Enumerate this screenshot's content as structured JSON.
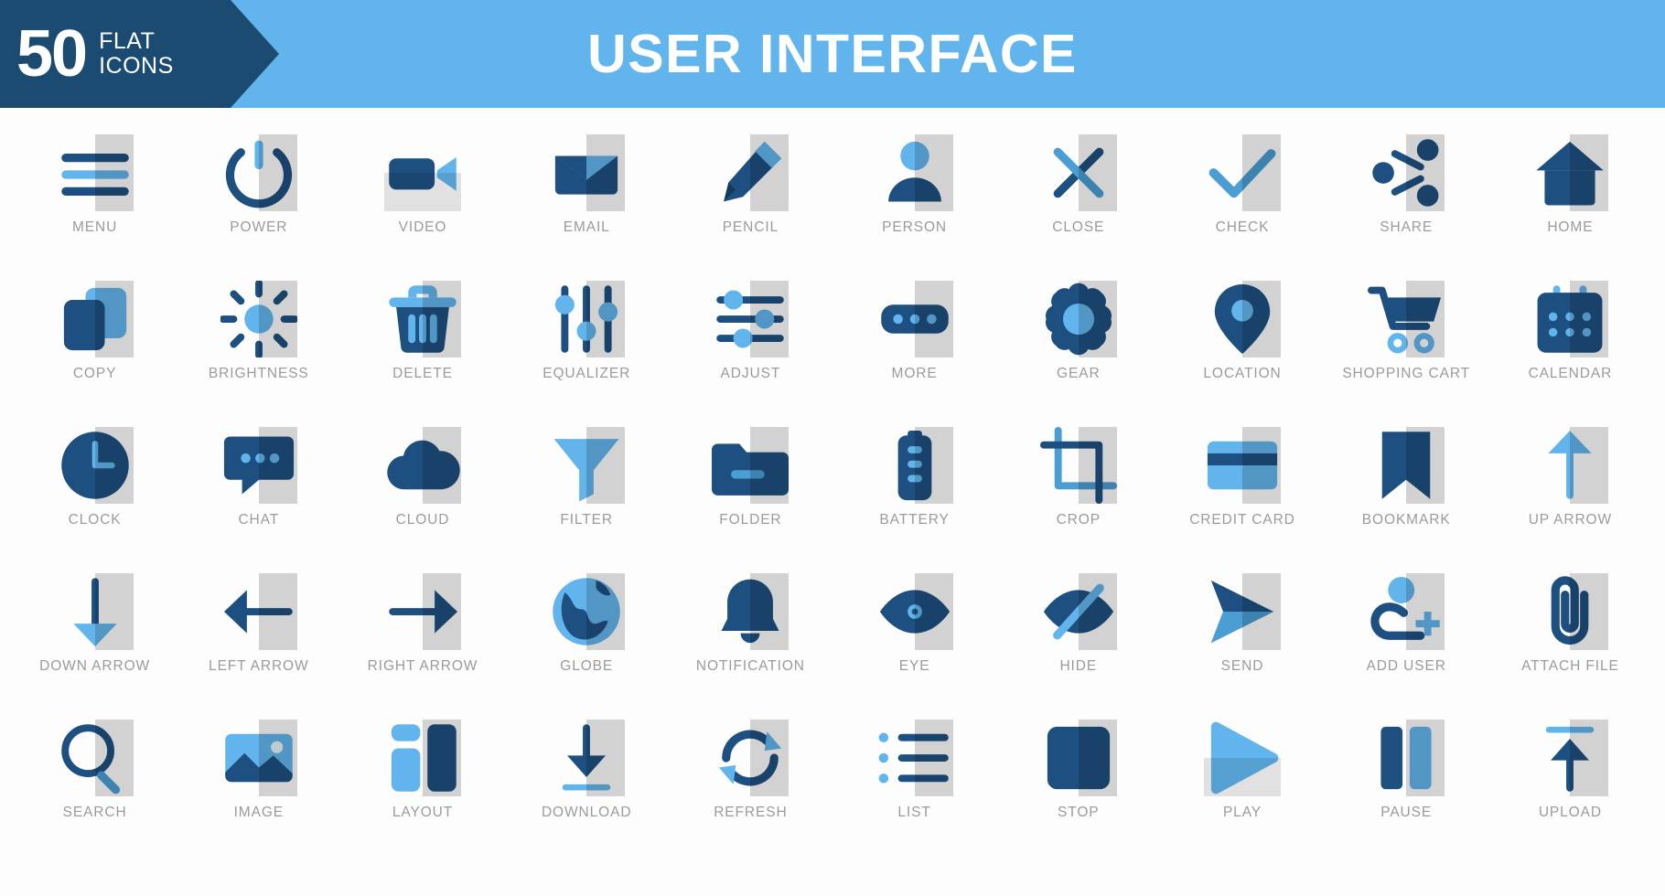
{
  "header": {
    "badge_number": "50",
    "badge_line1": "FLAT",
    "badge_line2": "ICONS",
    "title": "USER INTERFACE",
    "banner_color": "#61b5ec",
    "ribbon_color": "#1b4b70",
    "title_color": "#ffffff"
  },
  "palette": {
    "dark_navy": "#123a5c",
    "mid_navy": "#1d5080",
    "light_blue": "#62b5ec",
    "mid_blue": "#4a9ed4",
    "label_gray": "#9b9b9b",
    "background": "#ffffff"
  },
  "icons": [
    {
      "label": "MENU",
      "name": "menu-icon"
    },
    {
      "label": "POWER",
      "name": "power-icon"
    },
    {
      "label": "VIDEO",
      "name": "video-icon"
    },
    {
      "label": "EMAIL",
      "name": "email-icon"
    },
    {
      "label": "PENCIL",
      "name": "pencil-icon"
    },
    {
      "label": "PERSON",
      "name": "person-icon"
    },
    {
      "label": "CLOSE",
      "name": "close-icon"
    },
    {
      "label": "CHECK",
      "name": "check-icon"
    },
    {
      "label": "SHARE",
      "name": "share-icon"
    },
    {
      "label": "HOME",
      "name": "home-icon"
    },
    {
      "label": "COPY",
      "name": "copy-icon"
    },
    {
      "label": "BRIGHTNESS",
      "name": "brightness-icon"
    },
    {
      "label": "DELETE",
      "name": "delete-icon"
    },
    {
      "label": "EQUALIZER",
      "name": "equalizer-icon"
    },
    {
      "label": "ADJUST",
      "name": "adjust-icon"
    },
    {
      "label": "MORE",
      "name": "more-icon"
    },
    {
      "label": "GEAR",
      "name": "gear-icon"
    },
    {
      "label": "LOCATION",
      "name": "location-icon"
    },
    {
      "label": "SHOPPING CART",
      "name": "shopping-cart-icon"
    },
    {
      "label": "CALENDAR",
      "name": "calendar-icon"
    },
    {
      "label": "CLOCK",
      "name": "clock-icon"
    },
    {
      "label": "CHAT",
      "name": "chat-icon"
    },
    {
      "label": "CLOUD",
      "name": "cloud-icon"
    },
    {
      "label": "FILTER",
      "name": "filter-icon"
    },
    {
      "label": "FOLDER",
      "name": "folder-icon"
    },
    {
      "label": "BATTERY",
      "name": "battery-icon"
    },
    {
      "label": "CROP",
      "name": "crop-icon"
    },
    {
      "label": "CREDIT CARD",
      "name": "credit-card-icon"
    },
    {
      "label": "BOOKMARK",
      "name": "bookmark-icon"
    },
    {
      "label": "UP ARROW",
      "name": "up-arrow-icon"
    },
    {
      "label": "DOWN ARROW",
      "name": "down-arrow-icon"
    },
    {
      "label": "LEFT ARROW",
      "name": "left-arrow-icon"
    },
    {
      "label": "RIGHT ARROW",
      "name": "right-arrow-icon"
    },
    {
      "label": "GLOBE",
      "name": "globe-icon"
    },
    {
      "label": "NOTIFICATION",
      "name": "notification-icon"
    },
    {
      "label": "EYE",
      "name": "eye-icon"
    },
    {
      "label": "HIDE",
      "name": "hide-icon"
    },
    {
      "label": "SEND",
      "name": "send-icon"
    },
    {
      "label": "ADD USER",
      "name": "add-user-icon"
    },
    {
      "label": "ATTACH FILE",
      "name": "attach-file-icon"
    },
    {
      "label": "SEARCH",
      "name": "search-icon"
    },
    {
      "label": "IMAGE",
      "name": "image-icon"
    },
    {
      "label": "LAYOUT",
      "name": "layout-icon"
    },
    {
      "label": "DOWNLOAD",
      "name": "download-icon"
    },
    {
      "label": "REFRESH",
      "name": "refresh-icon"
    },
    {
      "label": "LIST",
      "name": "list-icon"
    },
    {
      "label": "STOP",
      "name": "stop-icon"
    },
    {
      "label": "PLAY",
      "name": "play-icon"
    },
    {
      "label": "PAUSE",
      "name": "pause-icon"
    },
    {
      "label": "UPLOAD",
      "name": "upload-icon"
    }
  ]
}
